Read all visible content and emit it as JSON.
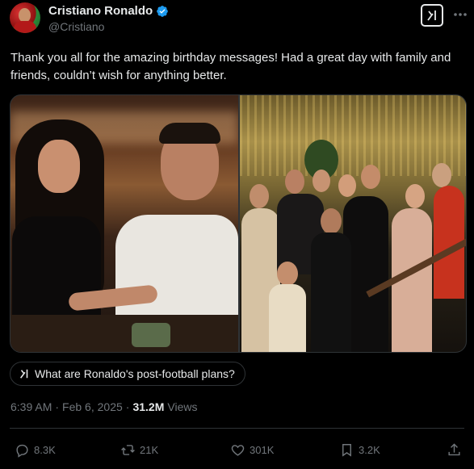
{
  "author": {
    "display_name": "Cristiano Ronaldo",
    "handle": "@Cristiano",
    "verified": true
  },
  "tweet": {
    "text": "Thank you all for the amazing birthday messages! Had a great day with family and friends, couldn’t wish for anything better."
  },
  "grok": {
    "question": "What are Ronaldo's post-football plans?"
  },
  "meta": {
    "time": "6:39 AM",
    "separator": "·",
    "date": "Feb 6, 2025",
    "separator2": "·",
    "views_count": "31.2M",
    "views_label": "Views"
  },
  "actions": {
    "replies": "8.3K",
    "reposts": "21K",
    "likes": "301K",
    "bookmarks": "3.2K"
  },
  "icons": {
    "avatar": "avatar-image",
    "verified": "verified-badge-icon",
    "grok": "grok-icon",
    "reply": "reply-icon",
    "repost": "repost-icon",
    "like": "heart-icon",
    "bookmark": "bookmark-icon",
    "share": "share-icon"
  },
  "colors": {
    "background": "#000000",
    "text": "#e7e9ea",
    "muted": "#71767b",
    "border": "#2f3336",
    "verified": "#1d9bf0"
  }
}
